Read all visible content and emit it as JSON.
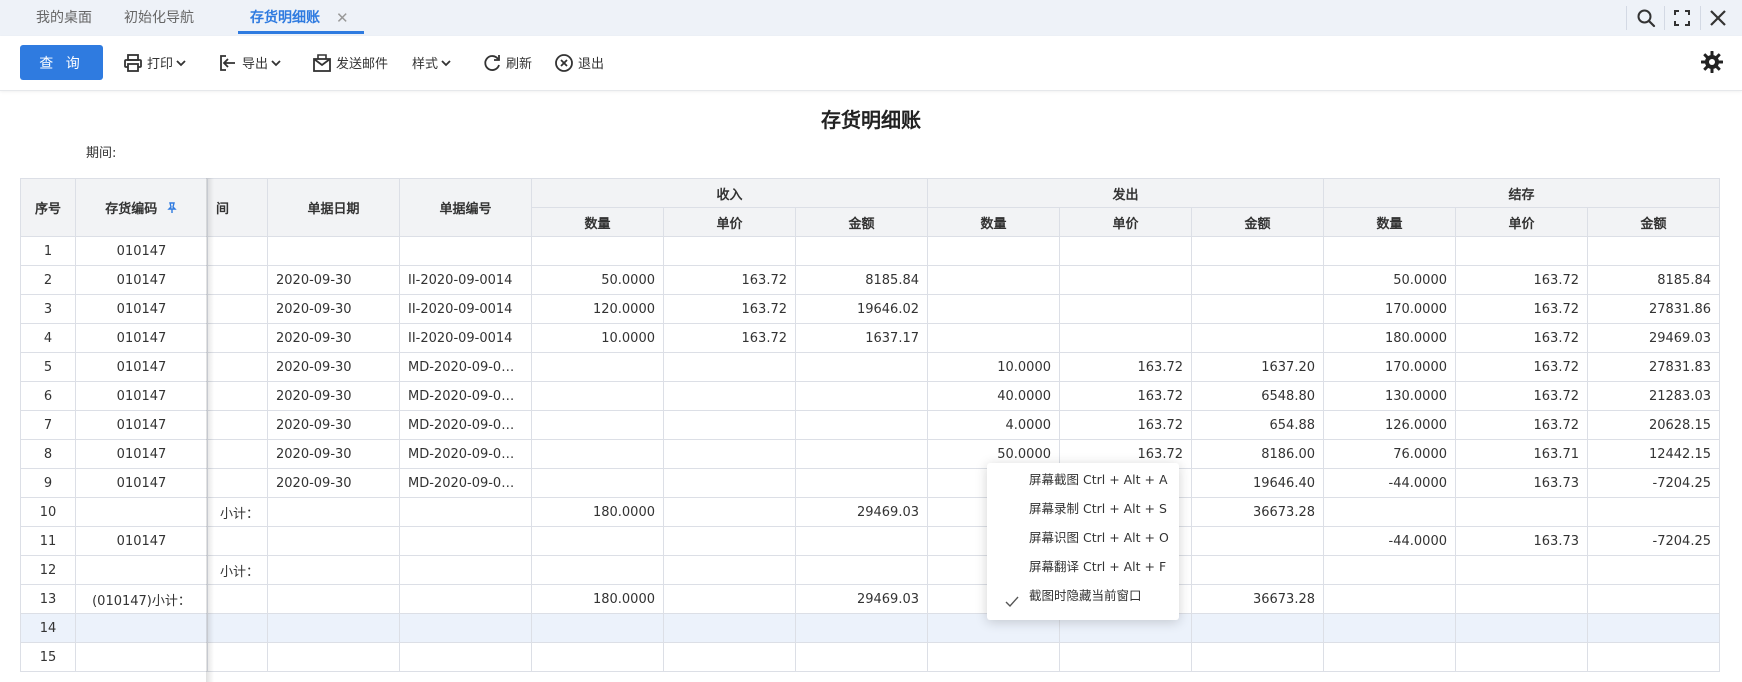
{
  "tabs": [
    {
      "label": "我的桌面",
      "active": false
    },
    {
      "label": "初始化导航",
      "active": false
    },
    {
      "label": "存货明细账",
      "active": true
    }
  ],
  "tab_close_glyph": "✕",
  "window_icons": [
    "search-icon",
    "fullscreen-icon",
    "close-icon"
  ],
  "toolbar": {
    "query_label": "查 询",
    "print_label": "打印",
    "export_label": "导出",
    "email_label": "发送邮件",
    "style_label": "样式",
    "refresh_label": "刷新",
    "exit_label": "退出"
  },
  "report": {
    "title": "存货明细账",
    "period_label": "期间:"
  },
  "table": {
    "headers": {
      "seq": "序号",
      "code": "存货编码",
      "hidden_partial": "间",
      "date": "单据日期",
      "docno": "单据编号",
      "in_group": "收入",
      "out_group": "发出",
      "bal_group": "结存",
      "qty": "数量",
      "price": "单价",
      "amount": "金额"
    },
    "rows": [
      {
        "seq": "1",
        "code": "010147",
        "hidden": "",
        "date": "",
        "docno": "",
        "in_qty": "",
        "in_price": "",
        "in_amt": "",
        "out_qty": "",
        "out_price": "",
        "out_amt": "",
        "bal_qty": "",
        "bal_price": "",
        "bal_amt": ""
      },
      {
        "seq": "2",
        "code": "010147",
        "hidden": "",
        "date": "2020-09-30",
        "docno": "II-2020-09-0014",
        "in_qty": "50.0000",
        "in_price": "163.72",
        "in_amt": "8185.84",
        "out_qty": "",
        "out_price": "",
        "out_amt": "",
        "bal_qty": "50.0000",
        "bal_price": "163.72",
        "bal_amt": "8185.84"
      },
      {
        "seq": "3",
        "code": "010147",
        "hidden": "",
        "date": "2020-09-30",
        "docno": "II-2020-09-0014",
        "in_qty": "120.0000",
        "in_price": "163.72",
        "in_amt": "19646.02",
        "out_qty": "",
        "out_price": "",
        "out_amt": "",
        "bal_qty": "170.0000",
        "bal_price": "163.72",
        "bal_amt": "27831.86"
      },
      {
        "seq": "4",
        "code": "010147",
        "hidden": "",
        "date": "2020-09-30",
        "docno": "II-2020-09-0014",
        "in_qty": "10.0000",
        "in_price": "163.72",
        "in_amt": "1637.17",
        "out_qty": "",
        "out_price": "",
        "out_amt": "",
        "bal_qty": "180.0000",
        "bal_price": "163.72",
        "bal_amt": "29469.03"
      },
      {
        "seq": "5",
        "code": "010147",
        "hidden": "",
        "date": "2020-09-30",
        "docno": "MD-2020-09-0…",
        "in_qty": "",
        "in_price": "",
        "in_amt": "",
        "out_qty": "10.0000",
        "out_price": "163.72",
        "out_amt": "1637.20",
        "bal_qty": "170.0000",
        "bal_price": "163.72",
        "bal_amt": "27831.83"
      },
      {
        "seq": "6",
        "code": "010147",
        "hidden": "",
        "date": "2020-09-30",
        "docno": "MD-2020-09-0…",
        "in_qty": "",
        "in_price": "",
        "in_amt": "",
        "out_qty": "40.0000",
        "out_price": "163.72",
        "out_amt": "6548.80",
        "bal_qty": "130.0000",
        "bal_price": "163.72",
        "bal_amt": "21283.03"
      },
      {
        "seq": "7",
        "code": "010147",
        "hidden": "",
        "date": "2020-09-30",
        "docno": "MD-2020-09-0…",
        "in_qty": "",
        "in_price": "",
        "in_amt": "",
        "out_qty": "4.0000",
        "out_price": "163.72",
        "out_amt": "654.88",
        "bal_qty": "126.0000",
        "bal_price": "163.72",
        "bal_amt": "20628.15"
      },
      {
        "seq": "8",
        "code": "010147",
        "hidden": "",
        "date": "2020-09-30",
        "docno": "MD-2020-09-0…",
        "in_qty": "",
        "in_price": "",
        "in_amt": "",
        "out_qty": "50.0000",
        "out_price": "163.72",
        "out_amt": "8186.00",
        "bal_qty": "76.0000",
        "bal_price": "163.71",
        "bal_amt": "12442.15"
      },
      {
        "seq": "9",
        "code": "010147",
        "hidden": "",
        "date": "2020-09-30",
        "docno": "MD-2020-09-0…",
        "in_qty": "",
        "in_price": "",
        "in_amt": "",
        "out_qty": "",
        "out_price": "",
        "out_amt": "19646.40",
        "bal_qty": "-44.0000",
        "bal_price": "163.73",
        "bal_amt": "-7204.25",
        "neg": true
      },
      {
        "seq": "10",
        "code": "",
        "hidden": "小计：",
        "date": "",
        "docno": "",
        "in_qty": "180.0000",
        "in_price": "",
        "in_amt": "29469.03",
        "out_qty": "",
        "out_price": "",
        "out_amt": "36673.28",
        "bal_qty": "",
        "bal_price": "",
        "bal_amt": ""
      },
      {
        "seq": "11",
        "code": "010147",
        "hidden": "",
        "date": "",
        "docno": "",
        "in_qty": "",
        "in_price": "",
        "in_amt": "",
        "out_qty": "",
        "out_price": "",
        "out_amt": "",
        "bal_qty": "-44.0000",
        "bal_price": "163.73",
        "bal_amt": "-7204.25",
        "neg": true
      },
      {
        "seq": "12",
        "code": "",
        "hidden": "小计：",
        "date": "",
        "docno": "",
        "in_qty": "",
        "in_price": "",
        "in_amt": "",
        "out_qty": "",
        "out_price": "",
        "out_amt": "",
        "bal_qty": "",
        "bal_price": "",
        "bal_amt": ""
      },
      {
        "seq": "13",
        "code": "(010147)小计：",
        "hidden": "",
        "date": "",
        "docno": "",
        "in_qty": "180.0000",
        "in_price": "",
        "in_amt": "29469.03",
        "out_qty": "",
        "out_price": "",
        "out_amt": "36673.28",
        "bal_qty": "",
        "bal_price": "",
        "bal_amt": ""
      },
      {
        "seq": "14",
        "code": "",
        "hidden": "",
        "date": "",
        "docno": "",
        "in_qty": "",
        "in_price": "",
        "in_amt": "",
        "out_qty": "",
        "out_price": "",
        "out_amt": "",
        "bal_qty": "",
        "bal_price": "",
        "bal_amt": "",
        "selected": true
      },
      {
        "seq": "15",
        "code": "",
        "hidden": "",
        "date": "",
        "docno": "",
        "in_qty": "",
        "in_price": "",
        "in_amt": "",
        "out_qty": "",
        "out_price": "",
        "out_amt": "",
        "bal_qty": "",
        "bal_price": "",
        "bal_amt": ""
      }
    ]
  },
  "context_menu": {
    "items": [
      "屏幕截图 Ctrl + Alt + A",
      "屏幕录制 Ctrl + Alt + S",
      "屏幕识图 Ctrl + Alt + O",
      "屏幕翻译 Ctrl + Alt + F",
      "截图时隐藏当前窗口"
    ],
    "checked_index": 4
  },
  "colors": {
    "accent": "#2f7be0",
    "link": "#2f57d9",
    "negative": "#e02020",
    "header_bg": "#f2f3f5",
    "tabbar_bg": "#eef2f8"
  }
}
